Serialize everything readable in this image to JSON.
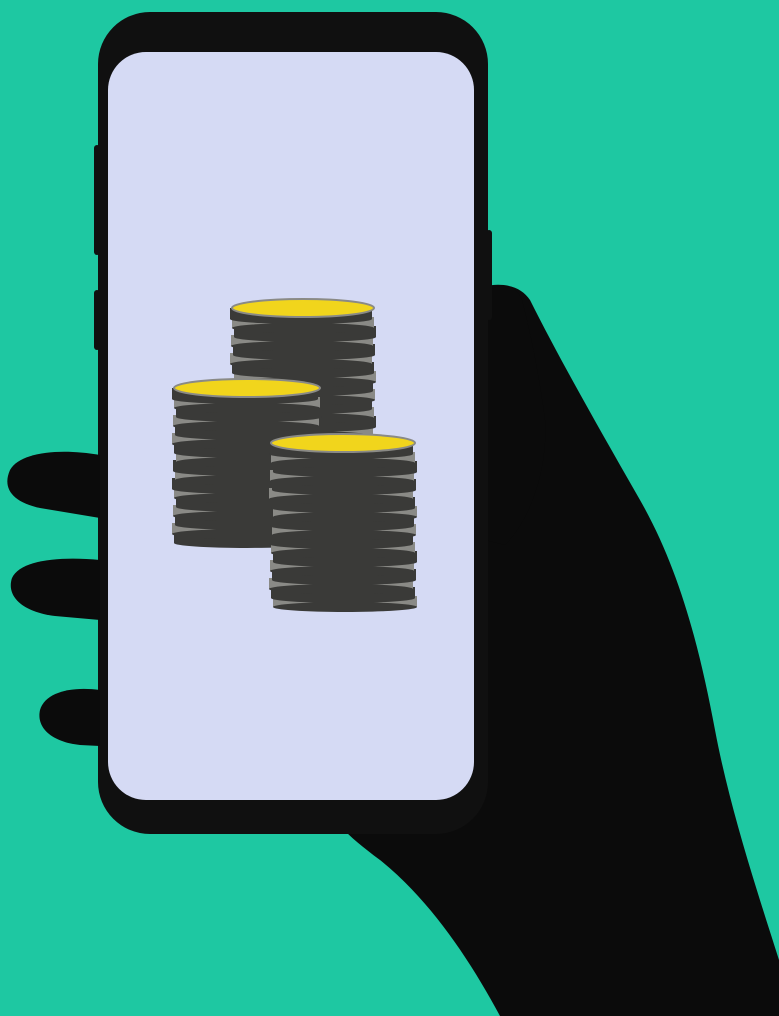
{
  "scene": {
    "description_icons": [
      "hand-icon",
      "smartphone-icon",
      "coin-stack-icon"
    ],
    "colors": {
      "background": "#1ec8a2",
      "hand": "#0b0b0b",
      "phone_body": "#101010",
      "screen": "#d5daf4",
      "coin_top": "#f1d51c",
      "coin_side": "#8a8a86",
      "coin_dark": "#3a3a38",
      "coin_light": "#c9c9c4"
    }
  }
}
